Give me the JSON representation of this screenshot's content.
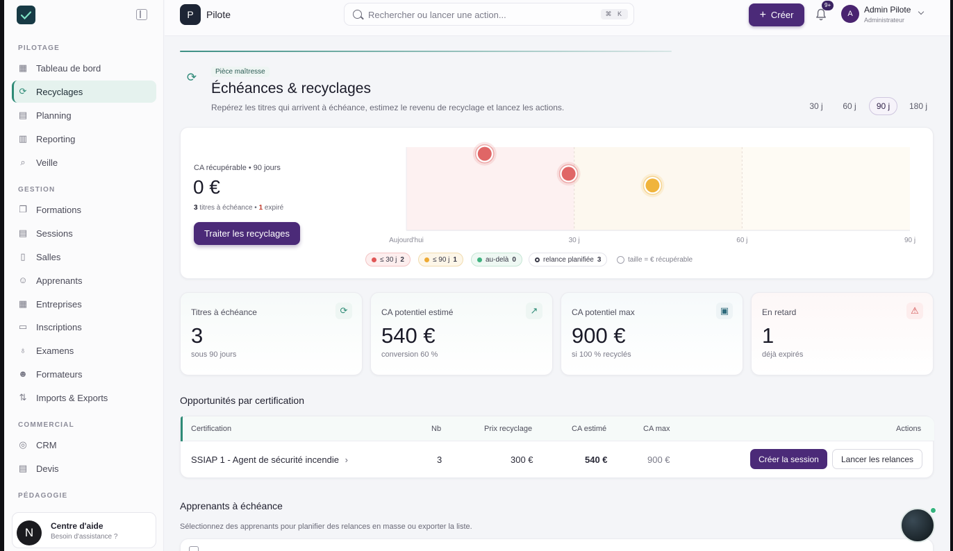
{
  "sidebar": {
    "sections": [
      {
        "label": "PILOTAGE"
      },
      {
        "label": "GESTION"
      },
      {
        "label": "COMMERCIAL"
      },
      {
        "label": "PÉDAGOGIE"
      }
    ],
    "items": [
      {
        "label": "Tableau de bord",
        "icon": "grid-icon"
      },
      {
        "label": "Recyclages",
        "icon": "refresh-icon"
      },
      {
        "label": "Planning",
        "icon": "calendar-icon"
      },
      {
        "label": "Reporting",
        "icon": "bar-chart-icon"
      },
      {
        "label": "Veille",
        "icon": "telescope-icon"
      },
      {
        "label": "Formations",
        "icon": "book-icon"
      },
      {
        "label": "Sessions",
        "icon": "calendar-icon"
      },
      {
        "label": "Salles",
        "icon": "building-icon"
      },
      {
        "label": "Apprenants",
        "icon": "users-icon"
      },
      {
        "label": "Entreprises",
        "icon": "office-icon"
      },
      {
        "label": "Inscriptions",
        "icon": "clipboard-icon"
      },
      {
        "label": "Examens",
        "icon": "award-icon"
      },
      {
        "label": "Formateurs",
        "icon": "user-cog-icon"
      },
      {
        "label": "Imports & Exports",
        "icon": "file-transfer-icon"
      },
      {
        "label": "CRM",
        "icon": "target-icon"
      },
      {
        "label": "Devis",
        "icon": "receipt-icon"
      }
    ],
    "help": {
      "title": "Centre d'aide",
      "subtitle": "Besoin d'assistance ?",
      "avatar": "N"
    }
  },
  "topbar": {
    "app_initial": "P",
    "app_name": "Pilote",
    "search_placeholder": "Rechercher ou lancer une action...",
    "shortcut": "⌘ K",
    "create_label": "Créer",
    "notif_count": "9+",
    "user_initial": "A",
    "user_name": "Admin Pilote",
    "user_role": "Administrateur"
  },
  "header": {
    "kicker": "Pièce maîtresse",
    "title": "Échéances & recyclages",
    "description": "Repérez les titres qui arrivent à échéance, estimez le revenu de recyclage et lancez les actions.",
    "periods": [
      "30 j",
      "60 j",
      "90 j",
      "180 j"
    ],
    "active_period": "90 j"
  },
  "hero": {
    "ca_label": "CA récupérable • 90 jours",
    "ca_value": "0 €",
    "titles_count": "3",
    "titles_text": "titres à échéance •",
    "expired_count": "1",
    "expired_text": "expiré",
    "button": "Traiter les recyclages"
  },
  "chart_data": {
    "type": "scatter",
    "x_tick_labels": [
      "Aujourd'hui",
      "30 j",
      "60 j",
      "90 j"
    ],
    "xlim": [
      0,
      90
    ],
    "x_unit": "jours",
    "points": [
      {
        "x": 14,
        "level": 0.92,
        "color": "#e06666"
      },
      {
        "x": 29,
        "level": 0.68,
        "color": "#e06666"
      },
      {
        "x": 44,
        "level": 0.54,
        "color": "#f0b43c"
      }
    ],
    "zones": [
      {
        "from": 0,
        "to": 30,
        "color": "#fdf1f1"
      },
      {
        "from": 30,
        "to": 60,
        "color": "#fdf8ef"
      },
      {
        "from": 60,
        "to": 90,
        "color": "#fefbf4"
      }
    ],
    "legend": [
      {
        "label": "≤ 30 j",
        "count": "2",
        "color": "#e05656",
        "bg": "#fdeeee",
        "border": "#f3c4c4"
      },
      {
        "label": "≤ 90 j",
        "count": "1",
        "color": "#eeaa33",
        "bg": "#fdf6e8",
        "border": "#f1dcaf"
      },
      {
        "label": "au-delà",
        "count": "0",
        "color": "#3fb27f",
        "bg": "#eef8f3",
        "border": "#c6e6d5"
      },
      {
        "label": "relance planifiée",
        "count": "3",
        "color": "ring-dark",
        "bg": "#ffffff",
        "border": "#e3e3ea"
      },
      {
        "label": "taille = € récupérable",
        "count": "",
        "color": "ring-light",
        "bg": "transparent",
        "border": "transparent"
      }
    ],
    "grid": true
  },
  "kpis": [
    {
      "label": "Titres à échéance",
      "value": "3",
      "sub": "sous 90 jours",
      "icon": "refresh-icon",
      "icon_glyph": "⟳",
      "icon_color": "#2e8b76",
      "icon_bg": "#eef6f3",
      "tint": "#f6faf9"
    },
    {
      "label": "CA potentiel estimé",
      "value": "540 €",
      "sub": "conversion 60 %",
      "icon": "trending-up-icon",
      "icon_glyph": "↗",
      "icon_color": "#2e8b76",
      "icon_bg": "#eef6f3",
      "tint": "#f6faf9"
    },
    {
      "label": "CA potentiel max",
      "value": "900 €",
      "sub": "si 100 % recyclés",
      "icon": "wallet-icon",
      "icon_glyph": "▣",
      "icon_color": "#2e6a7b",
      "icon_bg": "#eef4f6",
      "tint": "#f6fafb"
    },
    {
      "label": "En retard",
      "value": "1",
      "sub": "déjà expirés",
      "icon": "warning-icon",
      "icon_glyph": "⚠",
      "icon_color": "#d04a4a",
      "icon_bg": "#fdeded",
      "tint": "#fdf7f7"
    }
  ],
  "opportunities": {
    "title": "Opportunités par certification",
    "columns": [
      "Certification",
      "Nb",
      "Prix recyclage",
      "CA estimé",
      "CA max",
      "Actions"
    ],
    "rows": [
      {
        "certification": "SSIAP 1 - Agent de sécurité incendie",
        "nb": "3",
        "prix": "300 €",
        "ca_estime": "540 €",
        "ca_max": "900 €"
      }
    ],
    "create_session": "Créer la session",
    "launch_reminders": "Lancer les relances"
  },
  "learners": {
    "title": "Apprenants à échéance",
    "description": "Sélectionnez des apprenants pour planifier des relances en masse ou exporter la liste."
  }
}
